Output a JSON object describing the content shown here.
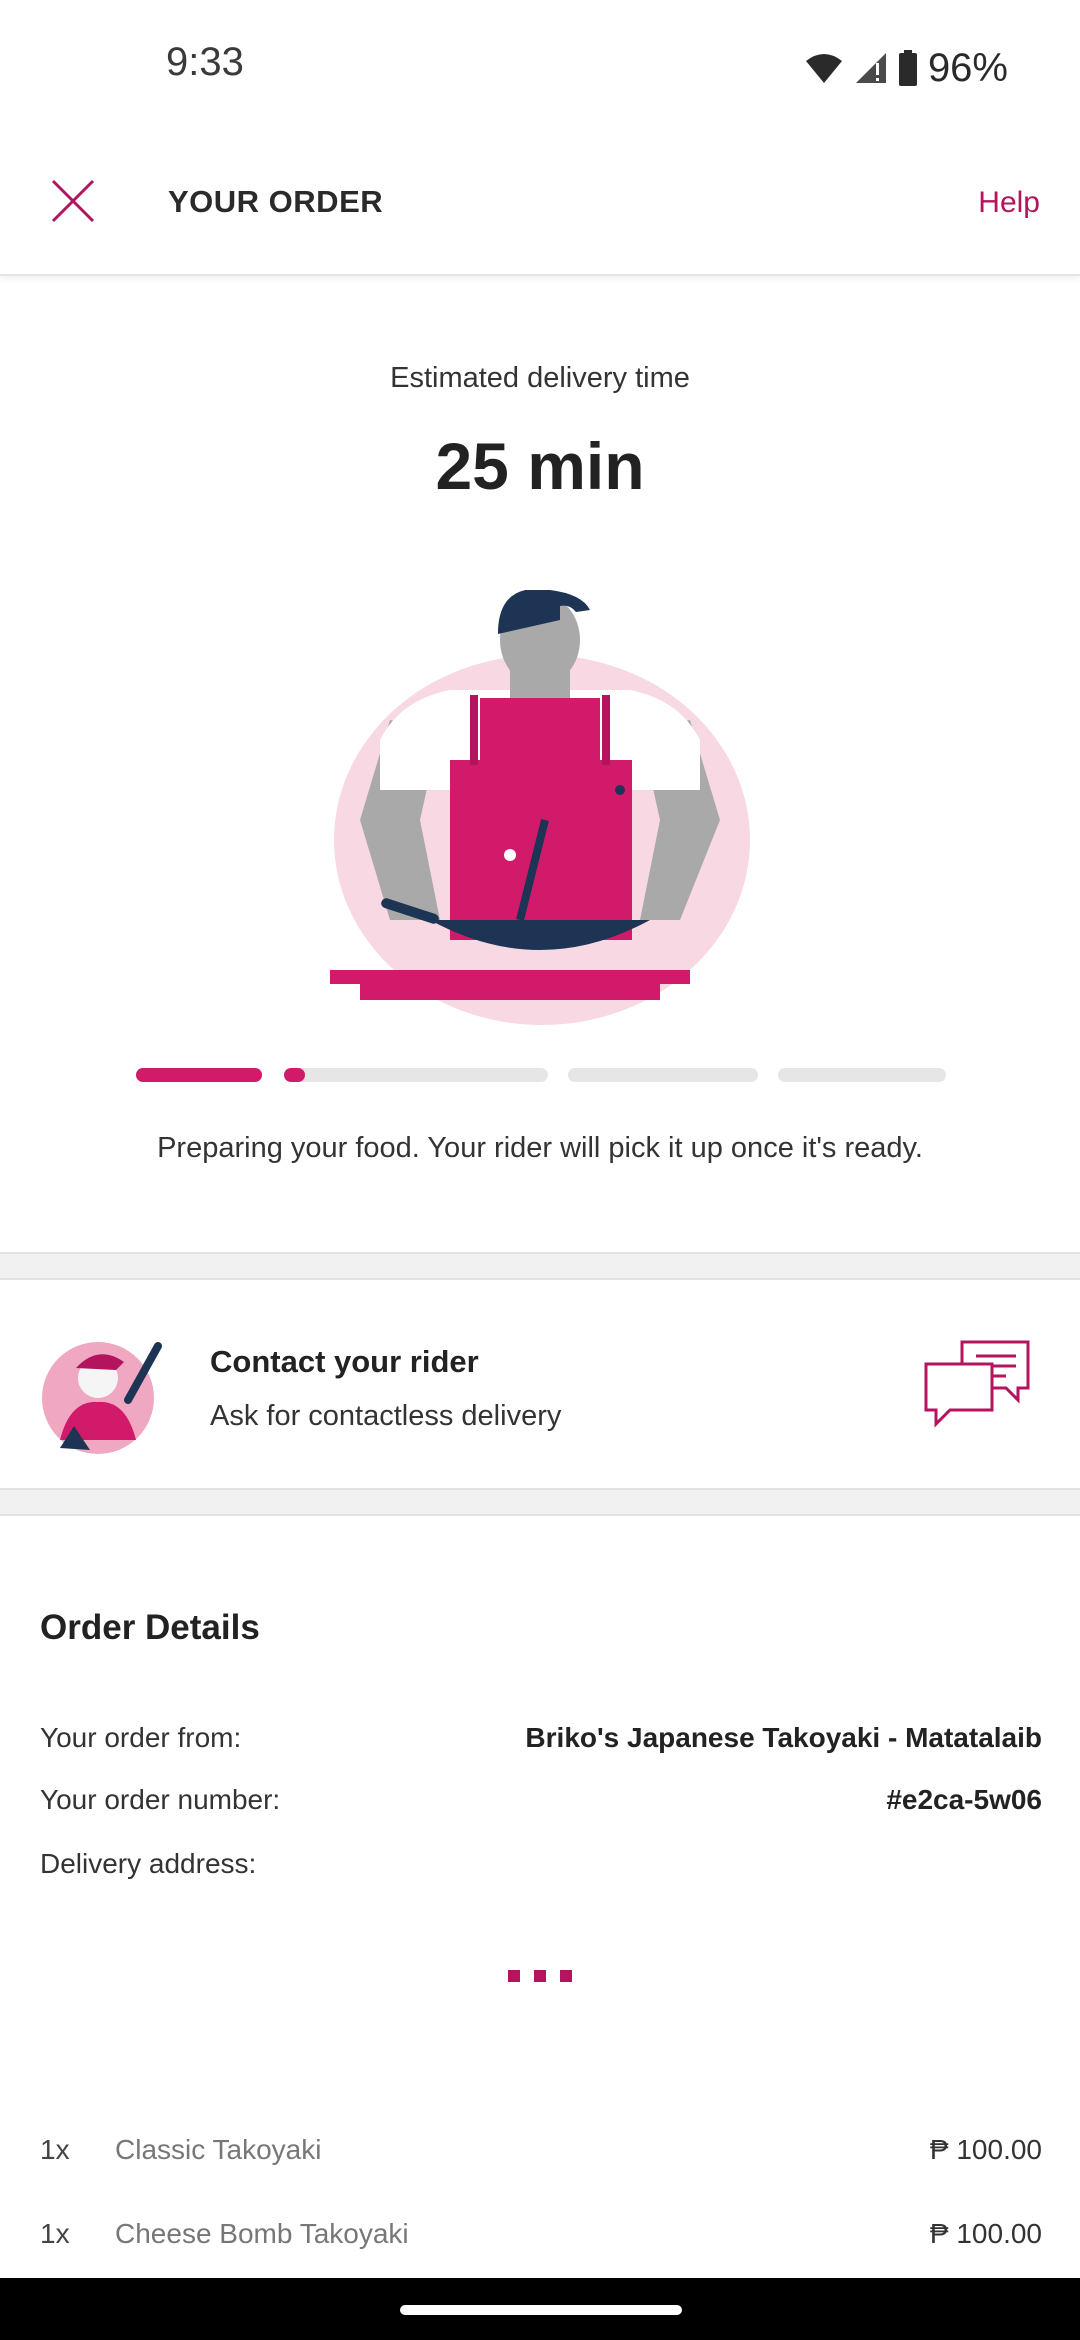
{
  "status_bar": {
    "time": "9:33",
    "battery": "96%"
  },
  "header": {
    "title": "YOUR ORDER",
    "help": "Help"
  },
  "eta": {
    "label": "Estimated delivery time",
    "value": "25 min"
  },
  "progress": {
    "steps": [
      1.0,
      0.08,
      0,
      0
    ]
  },
  "status_message": "Preparing your food. Your rider will pick it up once it's ready.",
  "contact": {
    "title": "Contact your rider",
    "subtitle": "Ask for contactless delivery"
  },
  "order_details": {
    "title": "Order Details",
    "rows": [
      {
        "label": "Your order from:",
        "value": "Briko's Japanese Takoyaki - Matatalaib"
      },
      {
        "label": "Your order number:",
        "value": "#e2ca-5w06"
      },
      {
        "label": "Delivery address:",
        "value": ""
      }
    ]
  },
  "items": [
    {
      "qty": "1x",
      "name": "Classic Takoyaki",
      "price": "₱ 100.00"
    },
    {
      "qty": "1x",
      "name": "Cheese Bomb Takoyaki",
      "price": "₱ 100.00"
    }
  ],
  "colors": {
    "accent": "#d21a6a",
    "brand": "#b3145d"
  }
}
